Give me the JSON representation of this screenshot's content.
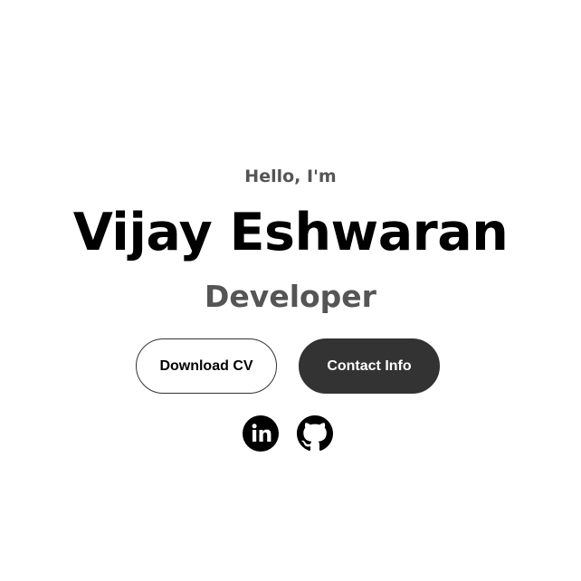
{
  "hero": {
    "greeting": "Hello, I'm",
    "name": "Vijay Eshwaran",
    "role": "Developer"
  },
  "buttons": {
    "download_label": "Download CV",
    "contact_label": "Contact Info"
  },
  "social": [
    {
      "icon": "linkedin-icon"
    },
    {
      "icon": "github-icon"
    }
  ],
  "colors": {
    "background": "#ffffff",
    "primary_text": "#000000",
    "secondary_text": "#555555",
    "button_dark": "#333333",
    "button_light_text": "#ffffff"
  }
}
